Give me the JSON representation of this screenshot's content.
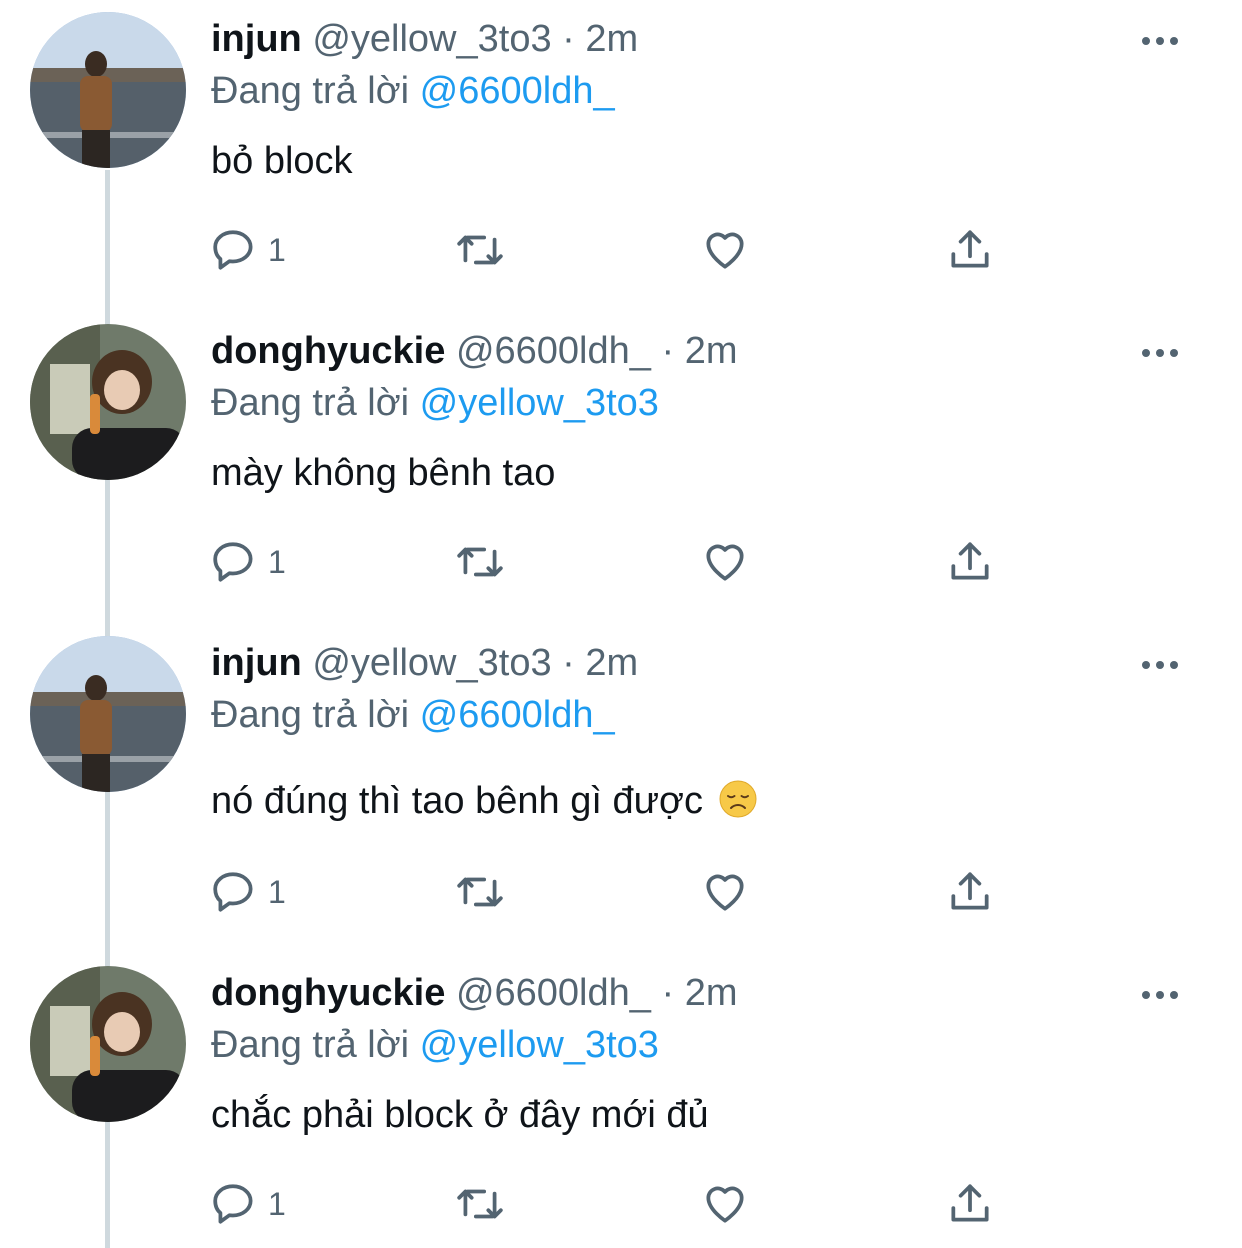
{
  "tweets": [
    {
      "name": "injun",
      "handle": "@yellow_3to3",
      "separator": "·",
      "time": "2m",
      "reply_prefix": "Đang trả lời",
      "reply_to": "@6600ldh_",
      "text": "bỏ block",
      "reply_count": "1",
      "avatar": "injun-avatar"
    },
    {
      "name": "donghyuckie",
      "handle": "@6600ldh_",
      "separator": "·",
      "time": "2m",
      "reply_prefix": "Đang trả lời",
      "reply_to": "@yellow_3to3",
      "text": "mày không bênh tao",
      "reply_count": "1",
      "avatar": "donghyuckie-avatar"
    },
    {
      "name": "injun",
      "handle": "@yellow_3to3",
      "separator": "·",
      "time": "2m",
      "reply_prefix": "Đang trả lời",
      "reply_to": "@6600ldh_",
      "text": "nó đúng thì tao bênh gì được",
      "emoji": "disappointed-face-emoji",
      "reply_count": "1",
      "avatar": "injun-avatar"
    },
    {
      "name": "donghyuckie",
      "handle": "@6600ldh_",
      "separator": "·",
      "time": "2m",
      "reply_prefix": "Đang trả lời",
      "reply_to": "@yellow_3to3",
      "text": "chắc phải block ở đây mới đủ",
      "reply_count": "1",
      "avatar": "donghyuckie-avatar"
    }
  ],
  "icons": [
    "reply-icon",
    "retweet-icon",
    "like-icon",
    "share-icon",
    "more-icon"
  ],
  "colors": {
    "text": "#0f1419",
    "secondary": "#536471",
    "mention": "#1d9bf0",
    "thread_line": "#cfd9de"
  }
}
